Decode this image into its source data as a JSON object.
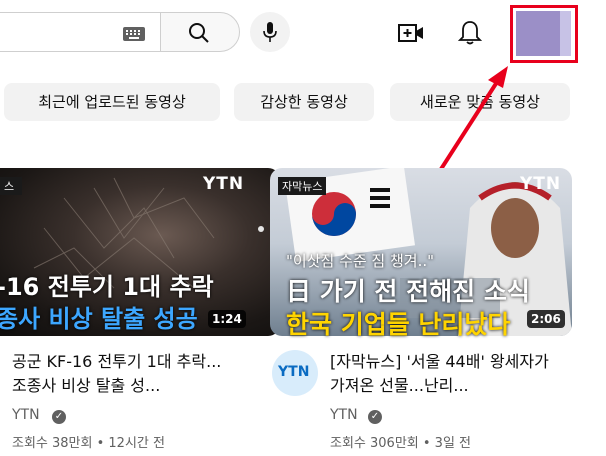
{
  "header": {
    "keyboard_icon": "keyboard-icon",
    "search_icon": "search-icon",
    "mic_icon": "mic-icon",
    "create_icon": "video-create-icon",
    "bell_icon": "bell-icon",
    "avatar_color": "#9b8fc7"
  },
  "chips": [
    {
      "label": "최근에 업로드된 동영상"
    },
    {
      "label": "감상한 동영상"
    },
    {
      "label": "새로운 맞춤 동영상"
    }
  ],
  "annotation": {
    "arrow_color": "#e8001c"
  },
  "videos": [
    {
      "thumb_logo": "YTN",
      "badge": "스",
      "thumb_line1": "-16 전투기 1대 추락",
      "thumb_line2": "종사 비상 탈출 성공",
      "duration": "1:24",
      "title": "공군 KF-16 전투기 1대 추락...조종사 비상 탈출 성...",
      "channel": "YTN",
      "stats": "조회수 38만회 • 12시간 전"
    },
    {
      "thumb_logo": "YTN",
      "badge": "자막뉴스",
      "thumb_line0": "\"이삿짐 수준 짐 챙겨..\"",
      "thumb_line1": "日 가기 전 전해진 소식",
      "thumb_line2": "한국 기업들 난리났다",
      "duration": "2:06",
      "title": "[자막뉴스] '서울 44배' 왕세자가 가져온 선물...난리...",
      "channel": "YTN",
      "channel_avatar_text": "YTN",
      "stats": "조회수 306만회 • 3일 전"
    }
  ]
}
